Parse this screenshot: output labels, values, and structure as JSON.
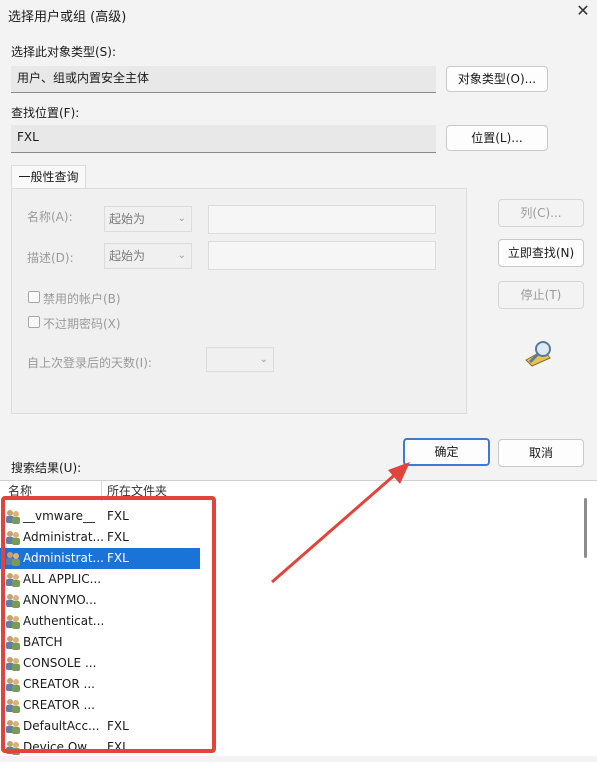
{
  "window": {
    "title": "选择用户或组 (高级)"
  },
  "object_type": {
    "label": "选择此对象类型(S):",
    "value": "用户、组或内置安全主体",
    "button": "对象类型(O)..."
  },
  "location": {
    "label": "查找位置(F):",
    "value": "FXL",
    "button": "位置(L)..."
  },
  "query": {
    "tab": "一般性查询",
    "name_label": "名称(A):",
    "name_mode": "起始为",
    "desc_label": "描述(D):",
    "desc_mode": "起始为",
    "disabled_accounts": "禁用的帐户(B)",
    "non_expiring": "不过期密码(X)",
    "days_label": "自上次登录后的天数(I):"
  },
  "buttons": {
    "columns": "列(C)...",
    "find_now": "立即查找(N)",
    "stop": "停止(T)",
    "ok": "确定",
    "cancel": "取消"
  },
  "results": {
    "label": "搜索结果(U):",
    "columns": [
      "名称",
      "所在文件夹"
    ],
    "rows": [
      {
        "name": "__vmware__",
        "folder": "FXL"
      },
      {
        "name": "Administrat...",
        "folder": "FXL"
      },
      {
        "name": "Administrat...",
        "folder": "FXL",
        "selected": true
      },
      {
        "name": "ALL APPLIC...",
        "folder": ""
      },
      {
        "name": "ANONYMO...",
        "folder": ""
      },
      {
        "name": "Authenticat...",
        "folder": ""
      },
      {
        "name": "BATCH",
        "folder": ""
      },
      {
        "name": "CONSOLE ...",
        "folder": ""
      },
      {
        "name": "CREATOR ...",
        "folder": ""
      },
      {
        "name": "CREATOR ...",
        "folder": ""
      },
      {
        "name": "DefaultAcc...",
        "folder": "FXL"
      },
      {
        "name": "Device Ow...",
        "folder": "FXL"
      }
    ]
  },
  "colors": {
    "accent": "#1a73d6",
    "annotation": "#e0443a"
  }
}
